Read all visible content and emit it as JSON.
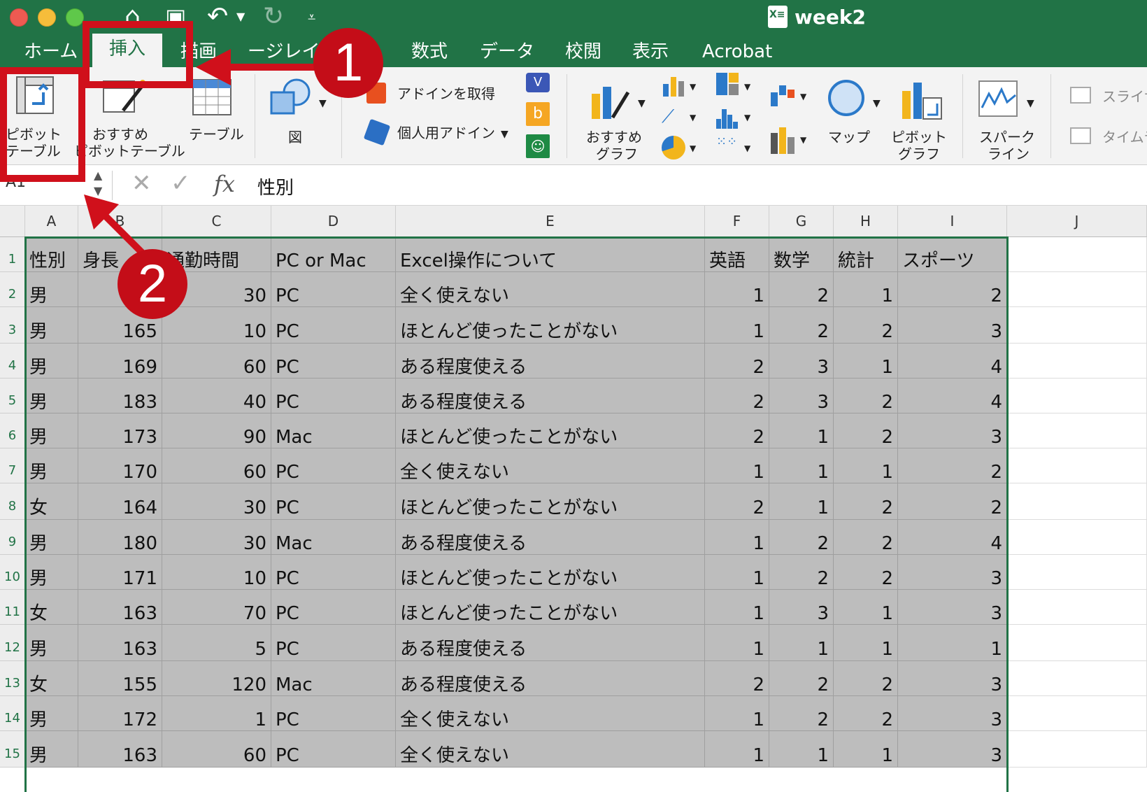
{
  "window": {
    "title": "week2",
    "doc_icon_text": "X≡"
  },
  "tabs": [
    "ホーム",
    "挿入",
    "描画",
    "ページレイアウト",
    "数式",
    "データ",
    "校閲",
    "表示",
    "Acrobat"
  ],
  "tab_display": {
    "home": "ホーム",
    "insert": "挿入",
    "draw": "描画",
    "page_layout": "ージレイアウト",
    "formulas": "数式",
    "data": "データ",
    "review": "校閲",
    "view": "表示",
    "acrobat": "Acrobat"
  },
  "ribbon": {
    "pivot_table": "ピボット\nテーブル",
    "pivot_table_1": "ピボット",
    "pivot_table_2": "テーブル",
    "recommended_pivot_1": "おすすめ",
    "recommended_pivot_2": "ピボットテーブル",
    "table": "テーブル",
    "illustrations": "図",
    "get_addins": "アドインを取得",
    "my_addins": "個人用アドイン",
    "recommended_charts_1": "おすすめ",
    "recommended_charts_2": "グラフ",
    "maps": "マップ",
    "pivot_chart_1": "ピボット",
    "pivot_chart_2": "グラフ",
    "sparklines_1": "スパーク",
    "sparklines_2": "ライン",
    "slicer": "スライサ",
    "timeline": "タイムラ"
  },
  "formula_bar": {
    "name_box": "A1",
    "fx": "fx",
    "value": "性別"
  },
  "columns": [
    "A",
    "B",
    "C",
    "D",
    "E",
    "F",
    "G",
    "H",
    "I",
    "J"
  ],
  "header_row": [
    "性別",
    "身長",
    "通勤時間",
    "PC or Mac",
    "Excel操作について",
    "英語",
    "数学",
    "統計",
    "スポーツ"
  ],
  "rows": [
    [
      "男",
      "",
      "30",
      "PC",
      "全く使えない",
      "1",
      "2",
      "1",
      "2"
    ],
    [
      "男",
      "165",
      "10",
      "PC",
      "ほとんど使ったことがない",
      "1",
      "2",
      "2",
      "3"
    ],
    [
      "男",
      "169",
      "60",
      "PC",
      "ある程度使える",
      "2",
      "3",
      "1",
      "4"
    ],
    [
      "男",
      "183",
      "40",
      "PC",
      "ある程度使える",
      "2",
      "3",
      "2",
      "4"
    ],
    [
      "男",
      "173",
      "90",
      "Mac",
      "ほとんど使ったことがない",
      "2",
      "1",
      "2",
      "3"
    ],
    [
      "男",
      "170",
      "60",
      "PC",
      "全く使えない",
      "1",
      "1",
      "1",
      "2"
    ],
    [
      "女",
      "164",
      "30",
      "PC",
      "ほとんど使ったことがない",
      "2",
      "1",
      "2",
      "2"
    ],
    [
      "男",
      "180",
      "30",
      "Mac",
      "ある程度使える",
      "1",
      "2",
      "2",
      "4"
    ],
    [
      "男",
      "171",
      "10",
      "PC",
      "ほとんど使ったことがない",
      "1",
      "2",
      "2",
      "3"
    ],
    [
      "女",
      "163",
      "70",
      "PC",
      "ほとんど使ったことがない",
      "1",
      "3",
      "1",
      "3"
    ],
    [
      "男",
      "163",
      "5",
      "PC",
      "ある程度使える",
      "1",
      "1",
      "1",
      "1"
    ],
    [
      "女",
      "155",
      "120",
      "Mac",
      "ある程度使える",
      "2",
      "2",
      "2",
      "3"
    ],
    [
      "男",
      "172",
      "1",
      "PC",
      "全く使えない",
      "1",
      "2",
      "2",
      "3"
    ],
    [
      "男",
      "163",
      "60",
      "PC",
      "全く使えない",
      "1",
      "1",
      "1",
      "3"
    ]
  ],
  "row_numbers": [
    "1",
    "2",
    "3",
    "4",
    "5",
    "6",
    "7",
    "8",
    "9",
    "10",
    "11",
    "12",
    "13",
    "14",
    "15"
  ],
  "annotations": {
    "step1": "1",
    "step2": "2"
  },
  "colors": {
    "excel_green": "#217346",
    "annotation_red": "#d0101b",
    "selection_gray": "#bdbdbd"
  }
}
